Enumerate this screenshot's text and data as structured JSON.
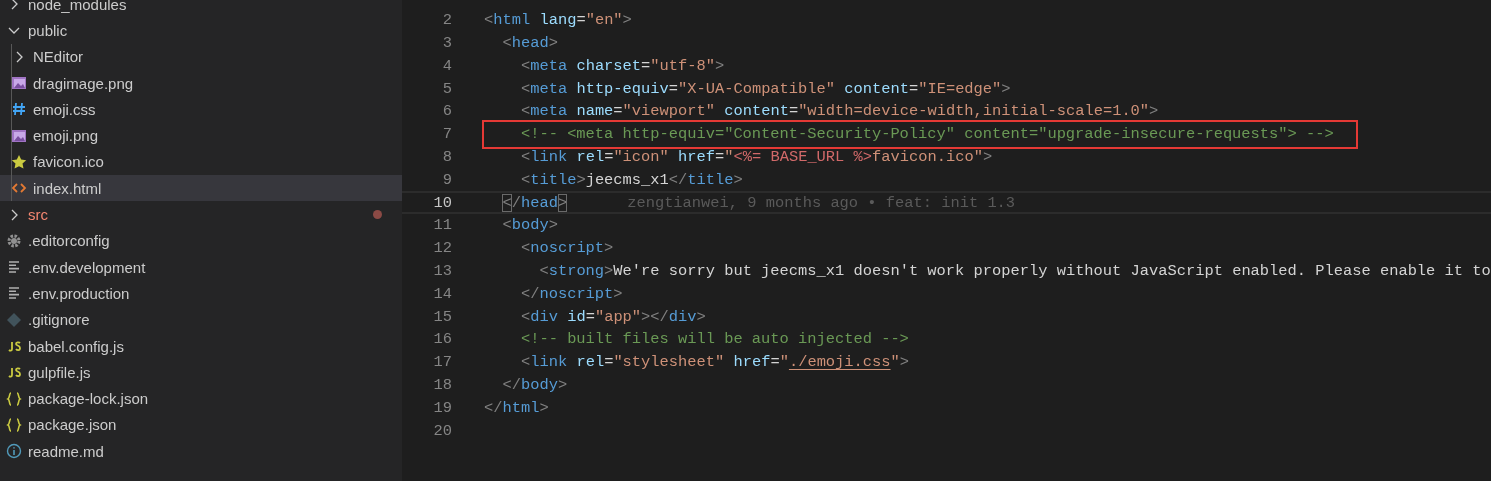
{
  "explorer": {
    "items": [
      {
        "kind": "folder",
        "name": "node_modules",
        "expanded": false,
        "selected": false,
        "modified": false
      },
      {
        "kind": "folder",
        "name": "public",
        "expanded": true,
        "selected": false,
        "modified": false,
        "children": [
          {
            "kind": "folder",
            "name": "NEditor",
            "expanded": false,
            "selected": false,
            "modified": false
          },
          {
            "kind": "image",
            "name": "dragimage.png",
            "selected": false,
            "modified": false
          },
          {
            "kind": "css",
            "name": "emoji.css",
            "selected": false,
            "modified": false
          },
          {
            "kind": "image",
            "name": "emoji.png",
            "selected": false,
            "modified": false
          },
          {
            "kind": "star",
            "name": "favicon.ico",
            "selected": false,
            "modified": false
          },
          {
            "kind": "html",
            "name": "index.html",
            "selected": true,
            "modified": false
          }
        ]
      },
      {
        "kind": "folder",
        "name": "src",
        "expanded": false,
        "selected": false,
        "modified": true
      },
      {
        "kind": "config",
        "name": ".editorconfig",
        "selected": false,
        "modified": false
      },
      {
        "kind": "text",
        "name": ".env.development",
        "selected": false,
        "modified": false
      },
      {
        "kind": "text",
        "name": ".env.production",
        "selected": false,
        "modified": false
      },
      {
        "kind": "git",
        "name": ".gitignore",
        "selected": false,
        "modified": false
      },
      {
        "kind": "js",
        "name": "babel.config.js",
        "selected": false,
        "modified": false
      },
      {
        "kind": "js",
        "name": "gulpfile.js",
        "selected": false,
        "modified": false
      },
      {
        "kind": "json",
        "name": "package-lock.json",
        "selected": false,
        "modified": false
      },
      {
        "kind": "json",
        "name": "package.json",
        "selected": false,
        "modified": false
      },
      {
        "kind": "info",
        "name": "readme.md",
        "selected": false,
        "modified": false
      }
    ]
  },
  "editor": {
    "lines": [
      {
        "number": "2",
        "current": false,
        "boxed": false,
        "tokens": [
          {
            "kind": "punct",
            "t": "<"
          },
          {
            "kind": "tag",
            "t": "html"
          },
          {
            "kind": "attr",
            "t": " lang"
          },
          {
            "kind": "text",
            "t": "="
          },
          {
            "kind": "str",
            "t": "\"en\""
          },
          {
            "kind": "punct",
            "t": ">"
          }
        ]
      },
      {
        "number": "3",
        "current": false,
        "boxed": false,
        "tokens": [
          {
            "kind": "punct",
            "t": "  <"
          },
          {
            "kind": "tag",
            "t": "head"
          },
          {
            "kind": "punct",
            "t": ">"
          }
        ]
      },
      {
        "number": "4",
        "current": false,
        "boxed": false,
        "tokens": [
          {
            "kind": "punct",
            "t": "    <"
          },
          {
            "kind": "tag",
            "t": "meta"
          },
          {
            "kind": "attr",
            "t": " charset"
          },
          {
            "kind": "text",
            "t": "="
          },
          {
            "kind": "str",
            "t": "\"utf-8\""
          },
          {
            "kind": "punct",
            "t": ">"
          }
        ]
      },
      {
        "number": "5",
        "current": false,
        "boxed": false,
        "tokens": [
          {
            "kind": "punct",
            "t": "    <"
          },
          {
            "kind": "tag",
            "t": "meta"
          },
          {
            "kind": "attr",
            "t": " http-equiv"
          },
          {
            "kind": "text",
            "t": "="
          },
          {
            "kind": "str",
            "t": "\"X-UA-Compatible\""
          },
          {
            "kind": "attr",
            "t": " content"
          },
          {
            "kind": "text",
            "t": "="
          },
          {
            "kind": "str",
            "t": "\"IE=edge\""
          },
          {
            "kind": "punct",
            "t": ">"
          }
        ]
      },
      {
        "number": "6",
        "current": false,
        "boxed": false,
        "tokens": [
          {
            "kind": "punct",
            "t": "    <"
          },
          {
            "kind": "tag",
            "t": "meta"
          },
          {
            "kind": "attr",
            "t": " name"
          },
          {
            "kind": "text",
            "t": "="
          },
          {
            "kind": "str",
            "t": "\"viewport\""
          },
          {
            "kind": "attr",
            "t": " content"
          },
          {
            "kind": "text",
            "t": "="
          },
          {
            "kind": "str",
            "t": "\"width=device-width,initial-scale=1.0\""
          },
          {
            "kind": "punct",
            "t": ">"
          }
        ]
      },
      {
        "number": "7",
        "current": false,
        "boxed": true,
        "tokens": [
          {
            "kind": "comment",
            "t": "    <!-- <meta http-equiv=\"Content-Security-Policy\" content=\"upgrade-insecure-requests\"> -->"
          }
        ]
      },
      {
        "number": "8",
        "current": false,
        "boxed": false,
        "tokens": [
          {
            "kind": "punct",
            "t": "    <"
          },
          {
            "kind": "tag",
            "t": "link"
          },
          {
            "kind": "attr",
            "t": " rel"
          },
          {
            "kind": "text",
            "t": "="
          },
          {
            "kind": "str",
            "t": "\"icon\""
          },
          {
            "kind": "attr",
            "t": " href"
          },
          {
            "kind": "text",
            "t": "="
          },
          {
            "kind": "str",
            "t": "\""
          },
          {
            "kind": "template",
            "t": "<%= BASE_URL %>"
          },
          {
            "kind": "str",
            "t": "favicon.ico\""
          },
          {
            "kind": "punct",
            "t": ">"
          }
        ]
      },
      {
        "number": "9",
        "current": false,
        "boxed": false,
        "tokens": [
          {
            "kind": "punct",
            "t": "    <"
          },
          {
            "kind": "tag",
            "t": "title"
          },
          {
            "kind": "punct",
            "t": ">"
          },
          {
            "kind": "text",
            "t": "jeecms_x1"
          },
          {
            "kind": "punct",
            "t": "</"
          },
          {
            "kind": "tag",
            "t": "title"
          },
          {
            "kind": "punct",
            "t": ">"
          }
        ]
      },
      {
        "number": "10",
        "current": true,
        "boxed": false,
        "blame": "zengtianwei, 9 months ago • feat: init 1.3",
        "tokens": [
          {
            "kind": "match",
            "t": "  <"
          },
          {
            "kind": "punct",
            "t": "/"
          },
          {
            "kind": "tag",
            "t": "head"
          },
          {
            "kind": "match",
            "t": ">"
          }
        ]
      },
      {
        "number": "11",
        "current": false,
        "boxed": false,
        "tokens": [
          {
            "kind": "punct",
            "t": "  <"
          },
          {
            "kind": "tag",
            "t": "body"
          },
          {
            "kind": "punct",
            "t": ">"
          }
        ]
      },
      {
        "number": "12",
        "current": false,
        "boxed": false,
        "tokens": [
          {
            "kind": "punct",
            "t": "    <"
          },
          {
            "kind": "tag",
            "t": "noscript"
          },
          {
            "kind": "punct",
            "t": ">"
          }
        ]
      },
      {
        "number": "13",
        "current": false,
        "boxed": false,
        "tokens": [
          {
            "kind": "punct",
            "t": "      <"
          },
          {
            "kind": "tag",
            "t": "strong"
          },
          {
            "kind": "punct",
            "t": ">"
          },
          {
            "kind": "text",
            "t": "We're sorry but jeecms_x1 doesn't work properly without JavaScript enabled. Please enable it to"
          }
        ]
      },
      {
        "number": "14",
        "current": false,
        "boxed": false,
        "tokens": [
          {
            "kind": "punct",
            "t": "    </"
          },
          {
            "kind": "tag",
            "t": "noscript"
          },
          {
            "kind": "punct",
            "t": ">"
          }
        ]
      },
      {
        "number": "15",
        "current": false,
        "boxed": false,
        "tokens": [
          {
            "kind": "punct",
            "t": "    <"
          },
          {
            "kind": "tag",
            "t": "div"
          },
          {
            "kind": "attr",
            "t": " id"
          },
          {
            "kind": "text",
            "t": "="
          },
          {
            "kind": "str",
            "t": "\"app\""
          },
          {
            "kind": "punct",
            "t": "></"
          },
          {
            "kind": "tag",
            "t": "div"
          },
          {
            "kind": "punct",
            "t": ">"
          }
        ]
      },
      {
        "number": "16",
        "current": false,
        "boxed": false,
        "tokens": [
          {
            "kind": "comment",
            "t": "    <!-- built files will be auto injected -->"
          }
        ]
      },
      {
        "number": "17",
        "current": false,
        "boxed": false,
        "tokens": [
          {
            "kind": "punct",
            "t": "    <"
          },
          {
            "kind": "tag",
            "t": "link"
          },
          {
            "kind": "attr",
            "t": " rel"
          },
          {
            "kind": "text",
            "t": "="
          },
          {
            "kind": "str",
            "t": "\"stylesheet\""
          },
          {
            "kind": "attr",
            "t": " href"
          },
          {
            "kind": "text",
            "t": "="
          },
          {
            "kind": "str",
            "t": "\""
          },
          {
            "kind": "link",
            "t": "./emoji.css"
          },
          {
            "kind": "str",
            "t": "\""
          },
          {
            "kind": "punct",
            "t": ">"
          }
        ]
      },
      {
        "number": "18",
        "current": false,
        "boxed": false,
        "tokens": [
          {
            "kind": "punct",
            "t": "  </"
          },
          {
            "kind": "tag",
            "t": "body"
          },
          {
            "kind": "punct",
            "t": ">"
          }
        ]
      },
      {
        "number": "19",
        "current": false,
        "boxed": false,
        "tokens": [
          {
            "kind": "punct",
            "t": "</"
          },
          {
            "kind": "tag",
            "t": "html"
          },
          {
            "kind": "punct",
            "t": ">"
          }
        ]
      },
      {
        "number": "20",
        "current": false,
        "boxed": false
      }
    ]
  }
}
